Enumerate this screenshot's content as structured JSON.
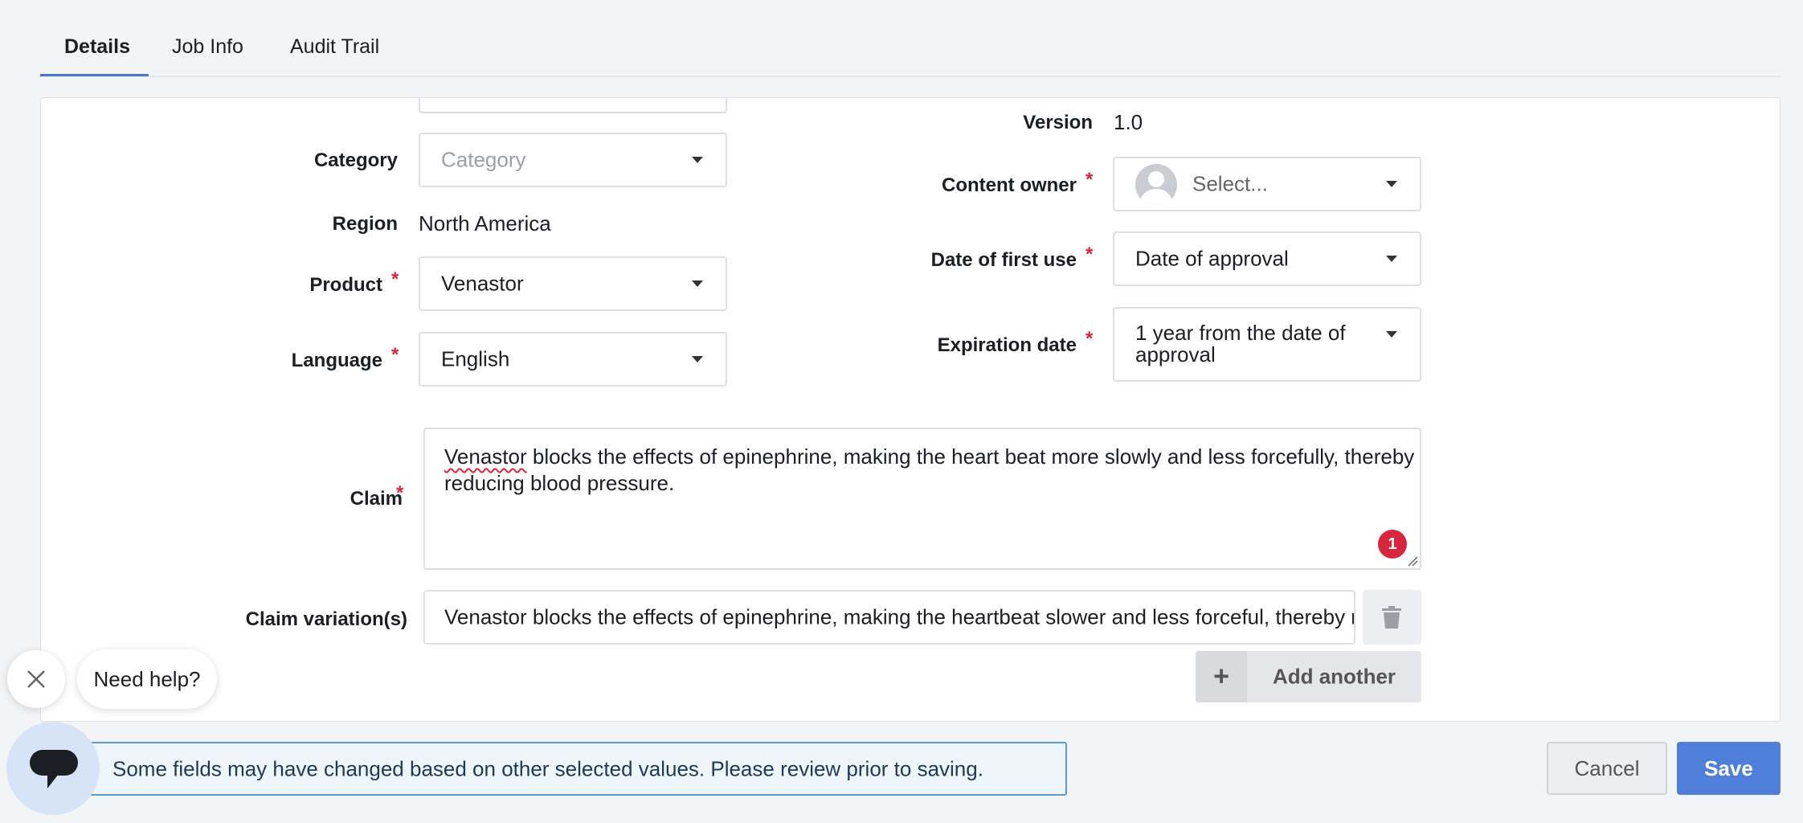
{
  "tabs": [
    {
      "label": "Details"
    },
    {
      "label": "Job Info"
    },
    {
      "label": "Audit Trail"
    }
  ],
  "form": {
    "category": {
      "label": "Category",
      "placeholder": "Category"
    },
    "region": {
      "label": "Region",
      "value": "North America"
    },
    "product": {
      "label": "Product",
      "value": "Venastor",
      "required_mark": "*"
    },
    "language": {
      "label": "Language",
      "value": "English",
      "required_mark": "*"
    },
    "version": {
      "label": "Version",
      "value": "1.0"
    },
    "content_owner": {
      "label": "Content owner",
      "placeholder": "Select...",
      "required_mark": "*"
    },
    "date_first_use": {
      "label": "Date of first use",
      "value": "Date of approval",
      "required_mark": "*"
    },
    "expiration_date": {
      "label": "Expiration date",
      "value_line1": "1 year from the date of",
      "value_line2": "approval",
      "required_mark": "*"
    },
    "claim": {
      "label": "Claim",
      "required_mark": "*",
      "first_word": "Venastor",
      "rest_line1": " blocks the effects of epinephrine, making the heart beat more slowly and less forcefully, thereby",
      "line2": "reducing blood pressure.",
      "badge_count": "1"
    },
    "claim_variation": {
      "label": "Claim variation(s)",
      "value": "Venastor blocks the effects of epinephrine, making the heartbeat slower and less forceful, thereby reducing blood pressure."
    },
    "add_another": {
      "plus": "+",
      "label": "Add another"
    }
  },
  "help": {
    "text": "Need help?"
  },
  "notice": {
    "text": "Some fields may have changed based on other selected values. Please review prior to saving."
  },
  "actions": {
    "cancel": "Cancel",
    "save": "Save"
  },
  "colors": {
    "accent": "#4f7fd9",
    "required": "#d7263d",
    "notice_border": "#5c9acb"
  },
  "icons": {
    "close": "close-icon",
    "chat": "chat-icon",
    "trash": "trash-icon",
    "avatar": "avatar-icon",
    "caret": "chevron-down-icon"
  }
}
